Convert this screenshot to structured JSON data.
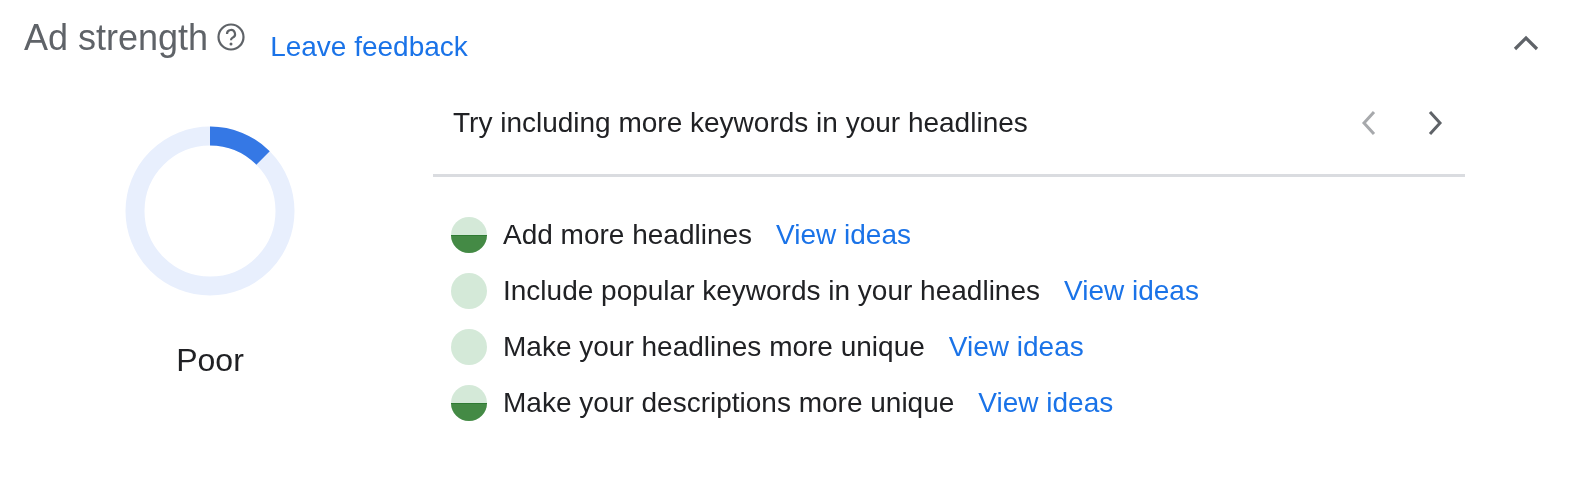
{
  "header": {
    "title": "Ad strength",
    "feedback_link": "Leave feedback",
    "expanded": true
  },
  "gauge": {
    "rating": "Poor"
  },
  "tip": {
    "text": "Try including more keywords in your headlines",
    "prev_disabled": true,
    "next_disabled": false
  },
  "suggestions": [
    {
      "text": "Add more headlines",
      "link": "View ideas",
      "kind": "half"
    },
    {
      "text": "Include popular keywords in your headlines",
      "link": "View ideas",
      "kind": "empty"
    },
    {
      "text": "Make your headlines more unique",
      "link": "View ideas",
      "kind": "empty"
    },
    {
      "text": "Make your descriptions more unique",
      "link": "View ideas",
      "kind": "half"
    }
  ]
}
